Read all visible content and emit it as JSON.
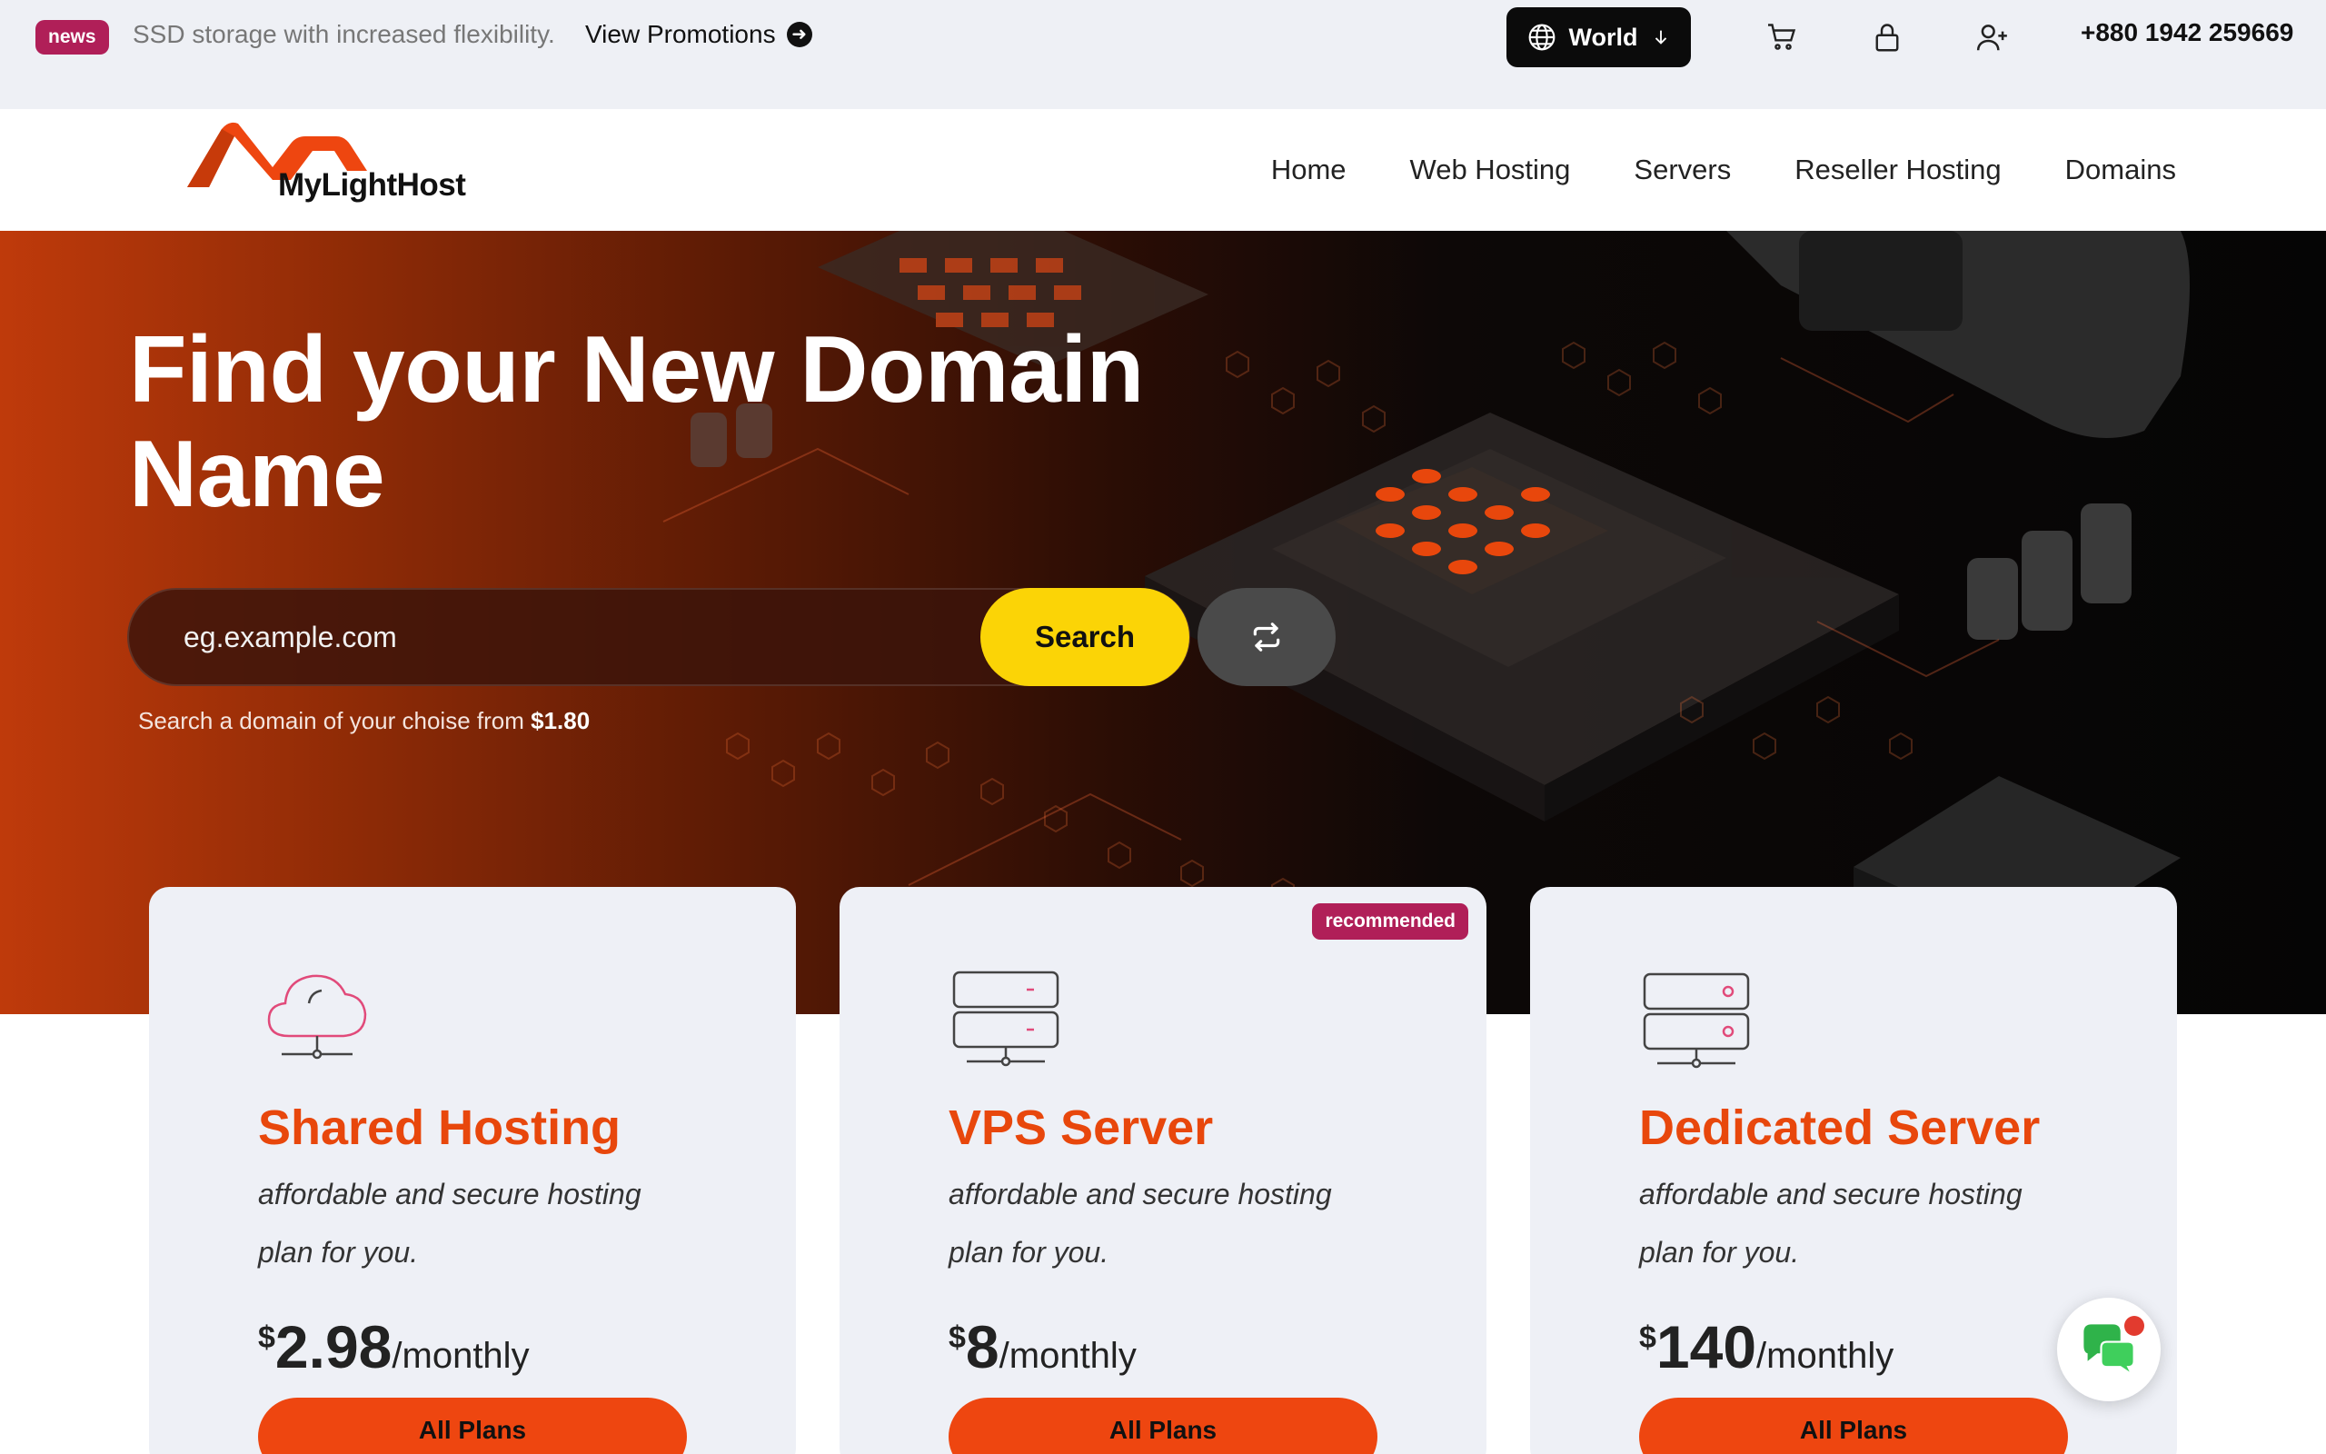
{
  "topbar": {
    "news_badge": "news",
    "promo_text": "SSD storage with increased flexibility.",
    "promo_link": "View Promotions",
    "region": "World",
    "phone": "+880 1942 259669",
    "icons": [
      "globe-icon",
      "arrow-down-icon",
      "cart-icon",
      "lock-icon",
      "user-plus-icon"
    ]
  },
  "nav": {
    "logo_text": "MyLightHost",
    "items": [
      "Home",
      "Web Hosting",
      "Servers",
      "Reseller Hosting",
      "Domains"
    ]
  },
  "hero": {
    "title": "Find your New Domain Name",
    "search_placeholder": "eg.example.com",
    "search_button": "Search",
    "hint_text": "Search a domain of your choise from",
    "hint_price": "$1.80"
  },
  "plans": [
    {
      "icon": "cloud-network-icon",
      "title": "Shared Hosting",
      "desc": "affordable and secure hosting plan for you.",
      "currency": "$",
      "price": "2.98",
      "period": "/monthly",
      "button": "All Plans",
      "badge": ""
    },
    {
      "icon": "server-network-icon",
      "title": "VPS Server",
      "desc": "affordable and secure hosting plan for you.",
      "currency": "$",
      "price": "8",
      "period": "/monthly",
      "button": "All Plans",
      "badge": "recommended"
    },
    {
      "icon": "dedicated-server-icon",
      "title": "Dedicated Server",
      "desc": "affordable and secure hosting plan for you.",
      "currency": "$",
      "price": "140",
      "period": "/monthly",
      "button": "All Plans",
      "badge": ""
    }
  ],
  "colors": {
    "accent_orange": "#ee4610",
    "title_orange": "#e8470c",
    "badge_magenta": "#b01f58",
    "search_yellow": "#fbd406"
  }
}
